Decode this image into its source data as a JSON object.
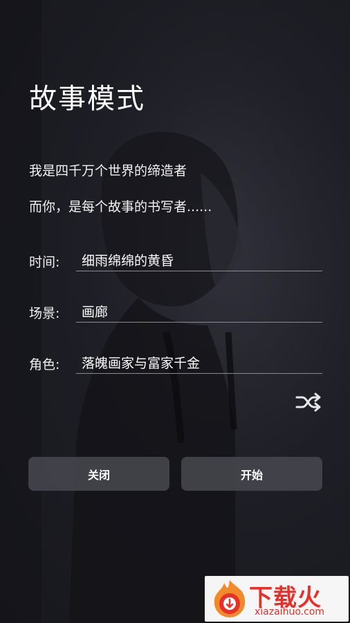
{
  "page": {
    "title": "故事模式",
    "intro_line1": "我是四千万个世界的缔造者",
    "intro_line2": "而你，是每个故事的书写者......"
  },
  "fields": {
    "time": {
      "label": "时间:",
      "value": "细雨绵绵的黄昏"
    },
    "scene": {
      "label": "场景:",
      "value": "画廊"
    },
    "role": {
      "label": "角色:",
      "value": "落魄画家与富家千金"
    }
  },
  "shuffle": {
    "icon": "shuffle-icon"
  },
  "buttons": {
    "close_label": "关闭",
    "start_label": "开始"
  },
  "watermark": {
    "brand": "下载火",
    "url": "xiazaihuo.com",
    "icon": "flame-logo-icon",
    "color": "#e8302a"
  },
  "colors": {
    "background": "#1b1b22",
    "button_bg": "#484850",
    "underline": "#8a8a92"
  }
}
